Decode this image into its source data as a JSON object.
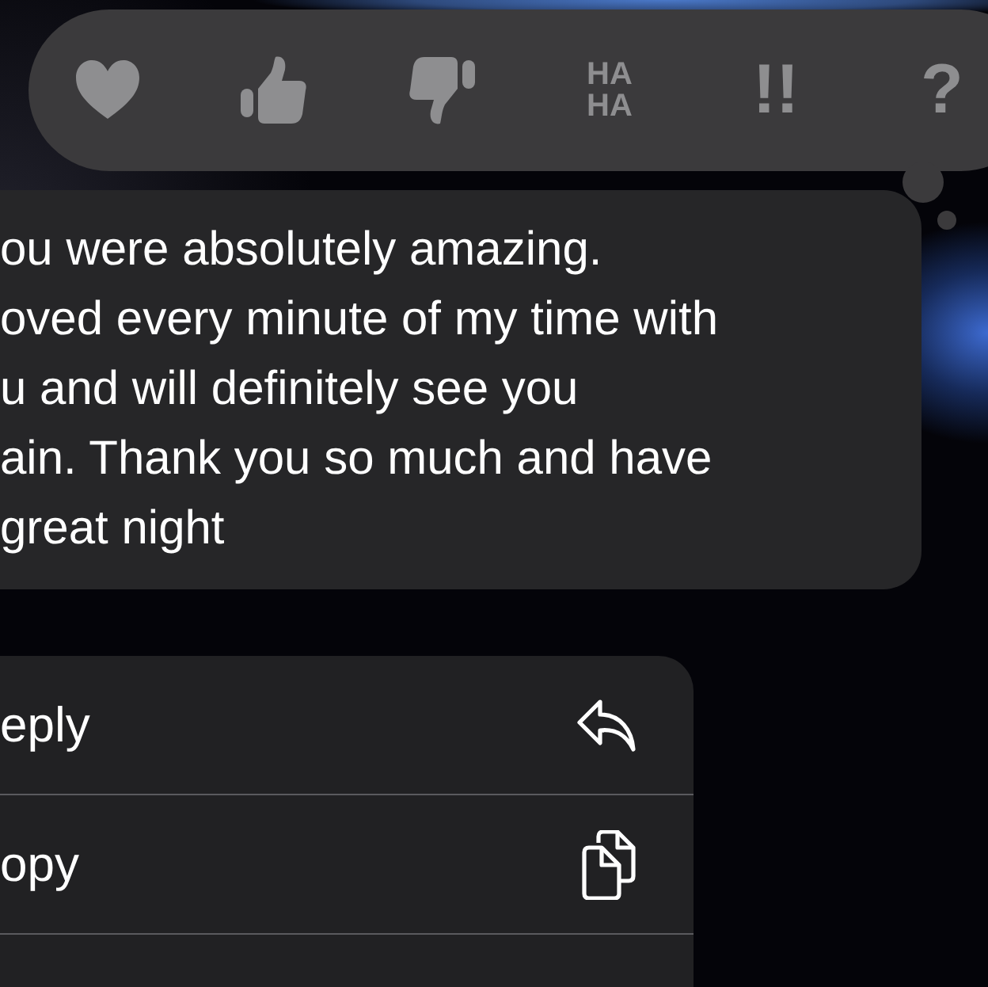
{
  "tapbacks": [
    {
      "kind": "heart"
    },
    {
      "kind": "thumbs-up"
    },
    {
      "kind": "thumbs-down"
    },
    {
      "kind": "haha",
      "label": "HA HA"
    },
    {
      "kind": "exclaim",
      "label": "!!"
    },
    {
      "kind": "question",
      "label": "?"
    }
  ],
  "message": {
    "lines": [
      "ou were absolutely amazing.",
      "oved every minute of my time with",
      "u and will definitely see you",
      "ain. Thank you so much and have",
      "great night"
    ]
  },
  "menu": [
    {
      "label": "eply",
      "kind": "reply"
    },
    {
      "label": "opy",
      "kind": "copy"
    }
  ]
}
